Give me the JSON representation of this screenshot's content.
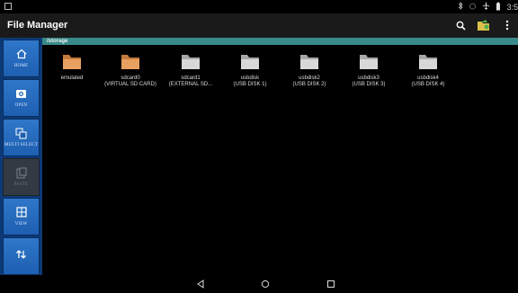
{
  "status_bar": {
    "time": "3:5",
    "icons": [
      "notification-icon",
      "bluetooth-icon",
      "alarm-icon",
      "airplane-icon",
      "battery-icon"
    ]
  },
  "header": {
    "title": "File Manager",
    "actions": [
      "search-icon",
      "folder-star-icon",
      "overflow-menu-icon"
    ]
  },
  "sidebar": {
    "items": [
      {
        "label": "HOME",
        "icon": "home-icon",
        "enabled": true
      },
      {
        "label": "OPEN",
        "icon": "open-icon",
        "enabled": true
      },
      {
        "label": "MULTI SELECT",
        "icon": "multi-select-icon",
        "enabled": true
      },
      {
        "label": "PASTE",
        "icon": "paste-icon",
        "enabled": false
      },
      {
        "label": "VIEW",
        "icon": "view-icon",
        "enabled": true
      },
      {
        "label": "",
        "icon": "sort-icon",
        "enabled": true
      }
    ]
  },
  "path": "/storage",
  "files": [
    {
      "name": "emulated",
      "detail": "",
      "color": "#e8a060"
    },
    {
      "name": "sdcard0",
      "detail": "(VIRTUAL SD CARD)",
      "color": "#e8a060"
    },
    {
      "name": "sdcard1",
      "detail": "(EXTERNAL SD...",
      "color": "#d8d8d8"
    },
    {
      "name": "usbdisk",
      "detail": "(USB DISK 1)",
      "color": "#d8d8d8"
    },
    {
      "name": "usbdisk2",
      "detail": "(USB DISK 2)",
      "color": "#d8d8d8"
    },
    {
      "name": "usbdisk3",
      "detail": "(USB DISK 3)",
      "color": "#d8d8d8"
    },
    {
      "name": "usbdisk4",
      "detail": "(USB DISK 4)",
      "color": "#d8d8d8"
    }
  ],
  "nav_bar": [
    "back-icon",
    "home-circle-icon",
    "recents-icon"
  ]
}
